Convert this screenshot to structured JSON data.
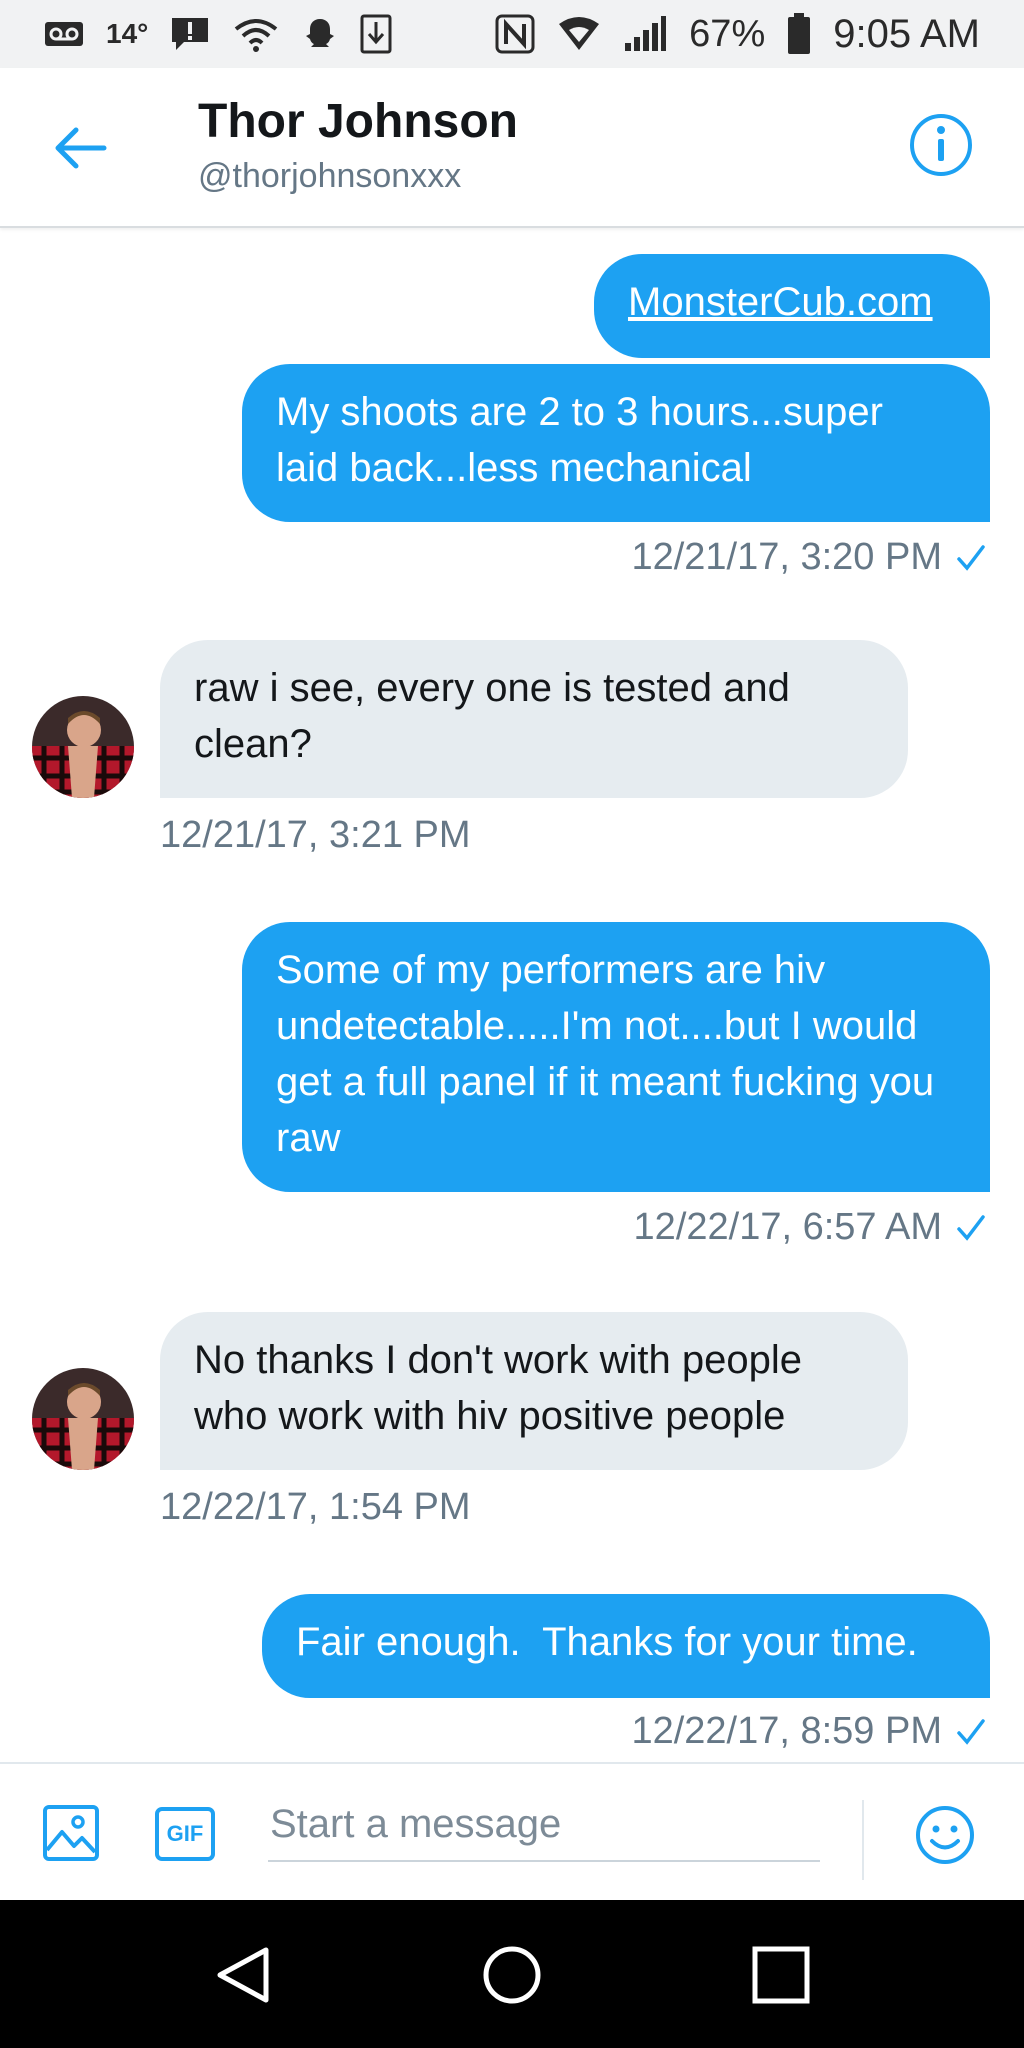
{
  "status_bar": {
    "temperature": "14°",
    "battery_percent": "67%",
    "time": "9:05 AM"
  },
  "header": {
    "name": "Thor Johnson",
    "handle": "@thorjohnsonxxx"
  },
  "messages": [
    {
      "direction": "out",
      "text": "MonsterCub.com",
      "is_link": true
    },
    {
      "direction": "out",
      "text": "My shoots are 2 to 3 hours...super laid back...less mechanical",
      "timestamp": "12/21/17, 3:20 PM",
      "read": true
    },
    {
      "direction": "in",
      "text": "raw i see, every one is tested and clean?",
      "timestamp": "12/21/17, 3:21 PM"
    },
    {
      "direction": "out",
      "text": "Some of my performers are hiv undetectable.....I'm not....but I would get a full panel if it meant fucking you raw",
      "timestamp": "12/22/17, 6:57 AM",
      "read": true
    },
    {
      "direction": "in",
      "text": "No thanks I don't work with people who work with hiv positive people",
      "timestamp": "12/22/17, 1:54 PM"
    },
    {
      "direction": "out",
      "text": "Fair enough.  Thanks for your time.",
      "timestamp": "12/22/17, 8:59 PM",
      "read": true
    }
  ],
  "composer": {
    "placeholder": "Start a message",
    "gif_label": "GIF"
  },
  "colors": {
    "accent": "#1da1f2",
    "incoming_bubble": "#e6ecf0",
    "muted_text": "#657786"
  },
  "icons": {
    "back": "arrow-left-icon",
    "info": "info-icon",
    "media": "image-icon",
    "emoji": "smiley-icon",
    "read_receipt": "checkmark-icon"
  }
}
